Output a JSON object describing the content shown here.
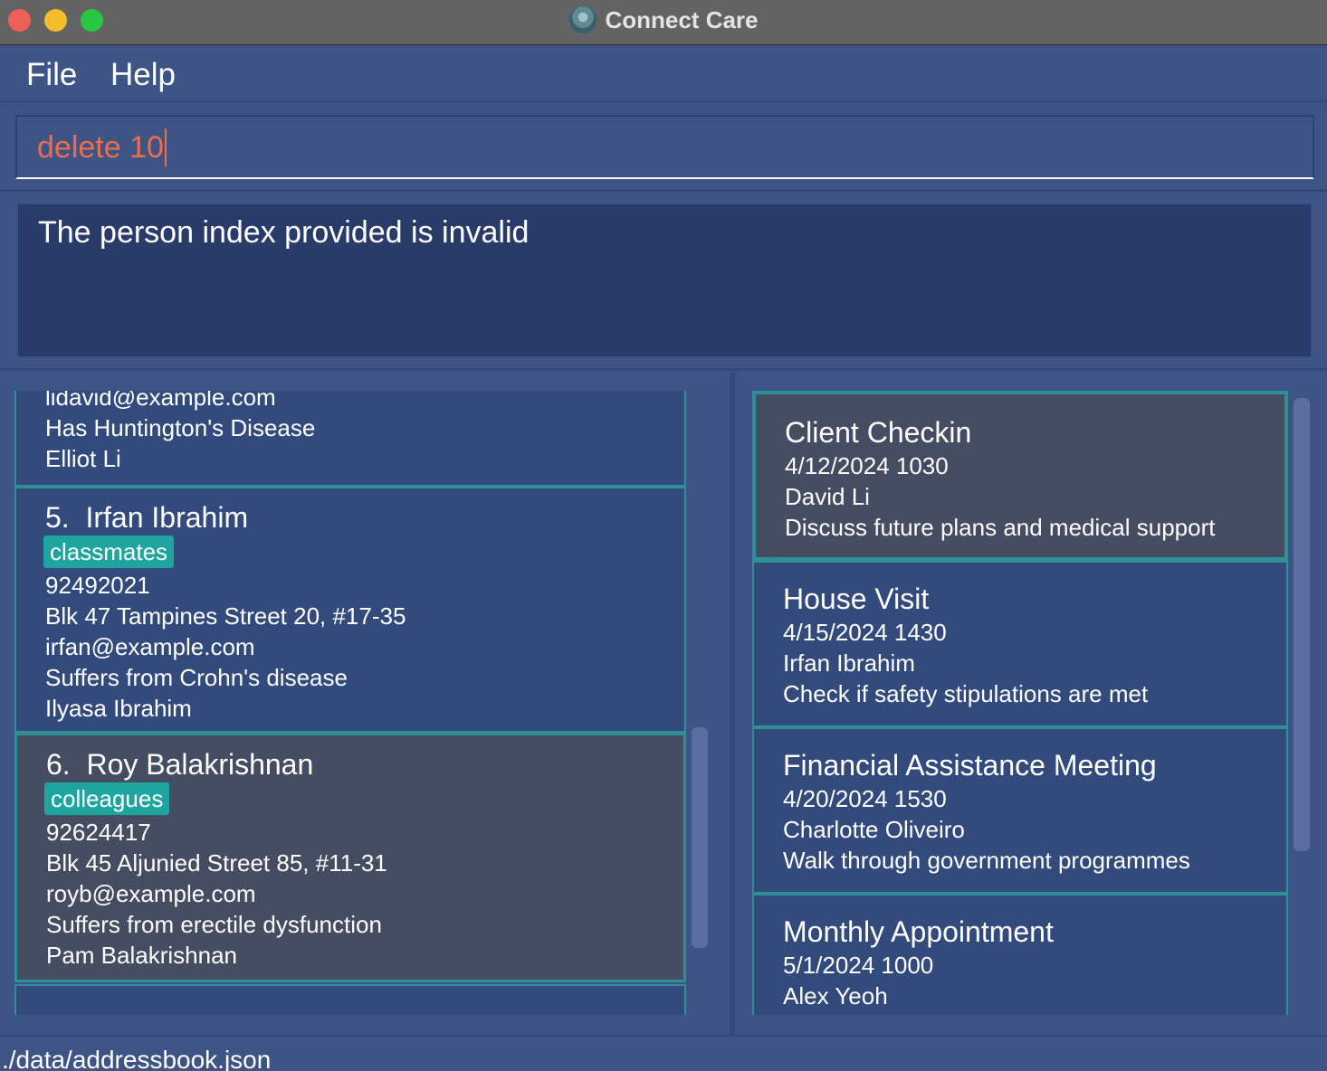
{
  "window": {
    "title": "Connect Care",
    "icon": "app-logo-icon"
  },
  "menu": {
    "file": "File",
    "help": "Help"
  },
  "command": {
    "value": "delete 10"
  },
  "result": {
    "message": "The person index provided is invalid"
  },
  "persons": [
    {
      "email": "lidavid@example.com",
      "note": "Has Huntington's Disease",
      "contact": "Elliot Li"
    },
    {
      "index": "5.",
      "name": "Irfan Ibrahim",
      "tag": "classmates",
      "phone": "92492021",
      "address": "Blk 47 Tampines Street 20, #17-35",
      "email": "irfan@example.com",
      "note": "Suffers from Crohn's disease",
      "contact": "Ilyasa Ibrahim"
    },
    {
      "index": "6.",
      "name": "Roy Balakrishnan",
      "tag": "colleagues",
      "phone": "92624417",
      "address": "Blk 45 Aljunied Street 85, #11-31",
      "email": "royb@example.com",
      "note": "Suffers from erectile dysfunction",
      "contact": "Pam Balakrishnan"
    }
  ],
  "appointments": [
    {
      "title": "Client Checkin",
      "datetime": "4/12/2024 1030",
      "person": "David Li",
      "description": "Discuss future plans and medical support"
    },
    {
      "title": "House Visit",
      "datetime": "4/15/2024 1430",
      "person": "Irfan Ibrahim",
      "description": "Check if safety stipulations are met"
    },
    {
      "title": "Financial Assistance Meeting",
      "datetime": "4/20/2024 1530",
      "person": "Charlotte Oliveiro",
      "description": "Walk through government programmes"
    },
    {
      "title": "Monthly Appointment",
      "datetime": "5/1/2024 1000",
      "person": "Alex Yeoh"
    }
  ],
  "status": {
    "filepath": "./data/addressbook.json"
  },
  "colors": {
    "accent_tag": "#1fa5a0",
    "border_teal": "#2e8f96",
    "command_text": "#e96d4e",
    "background": "#3d5484"
  }
}
